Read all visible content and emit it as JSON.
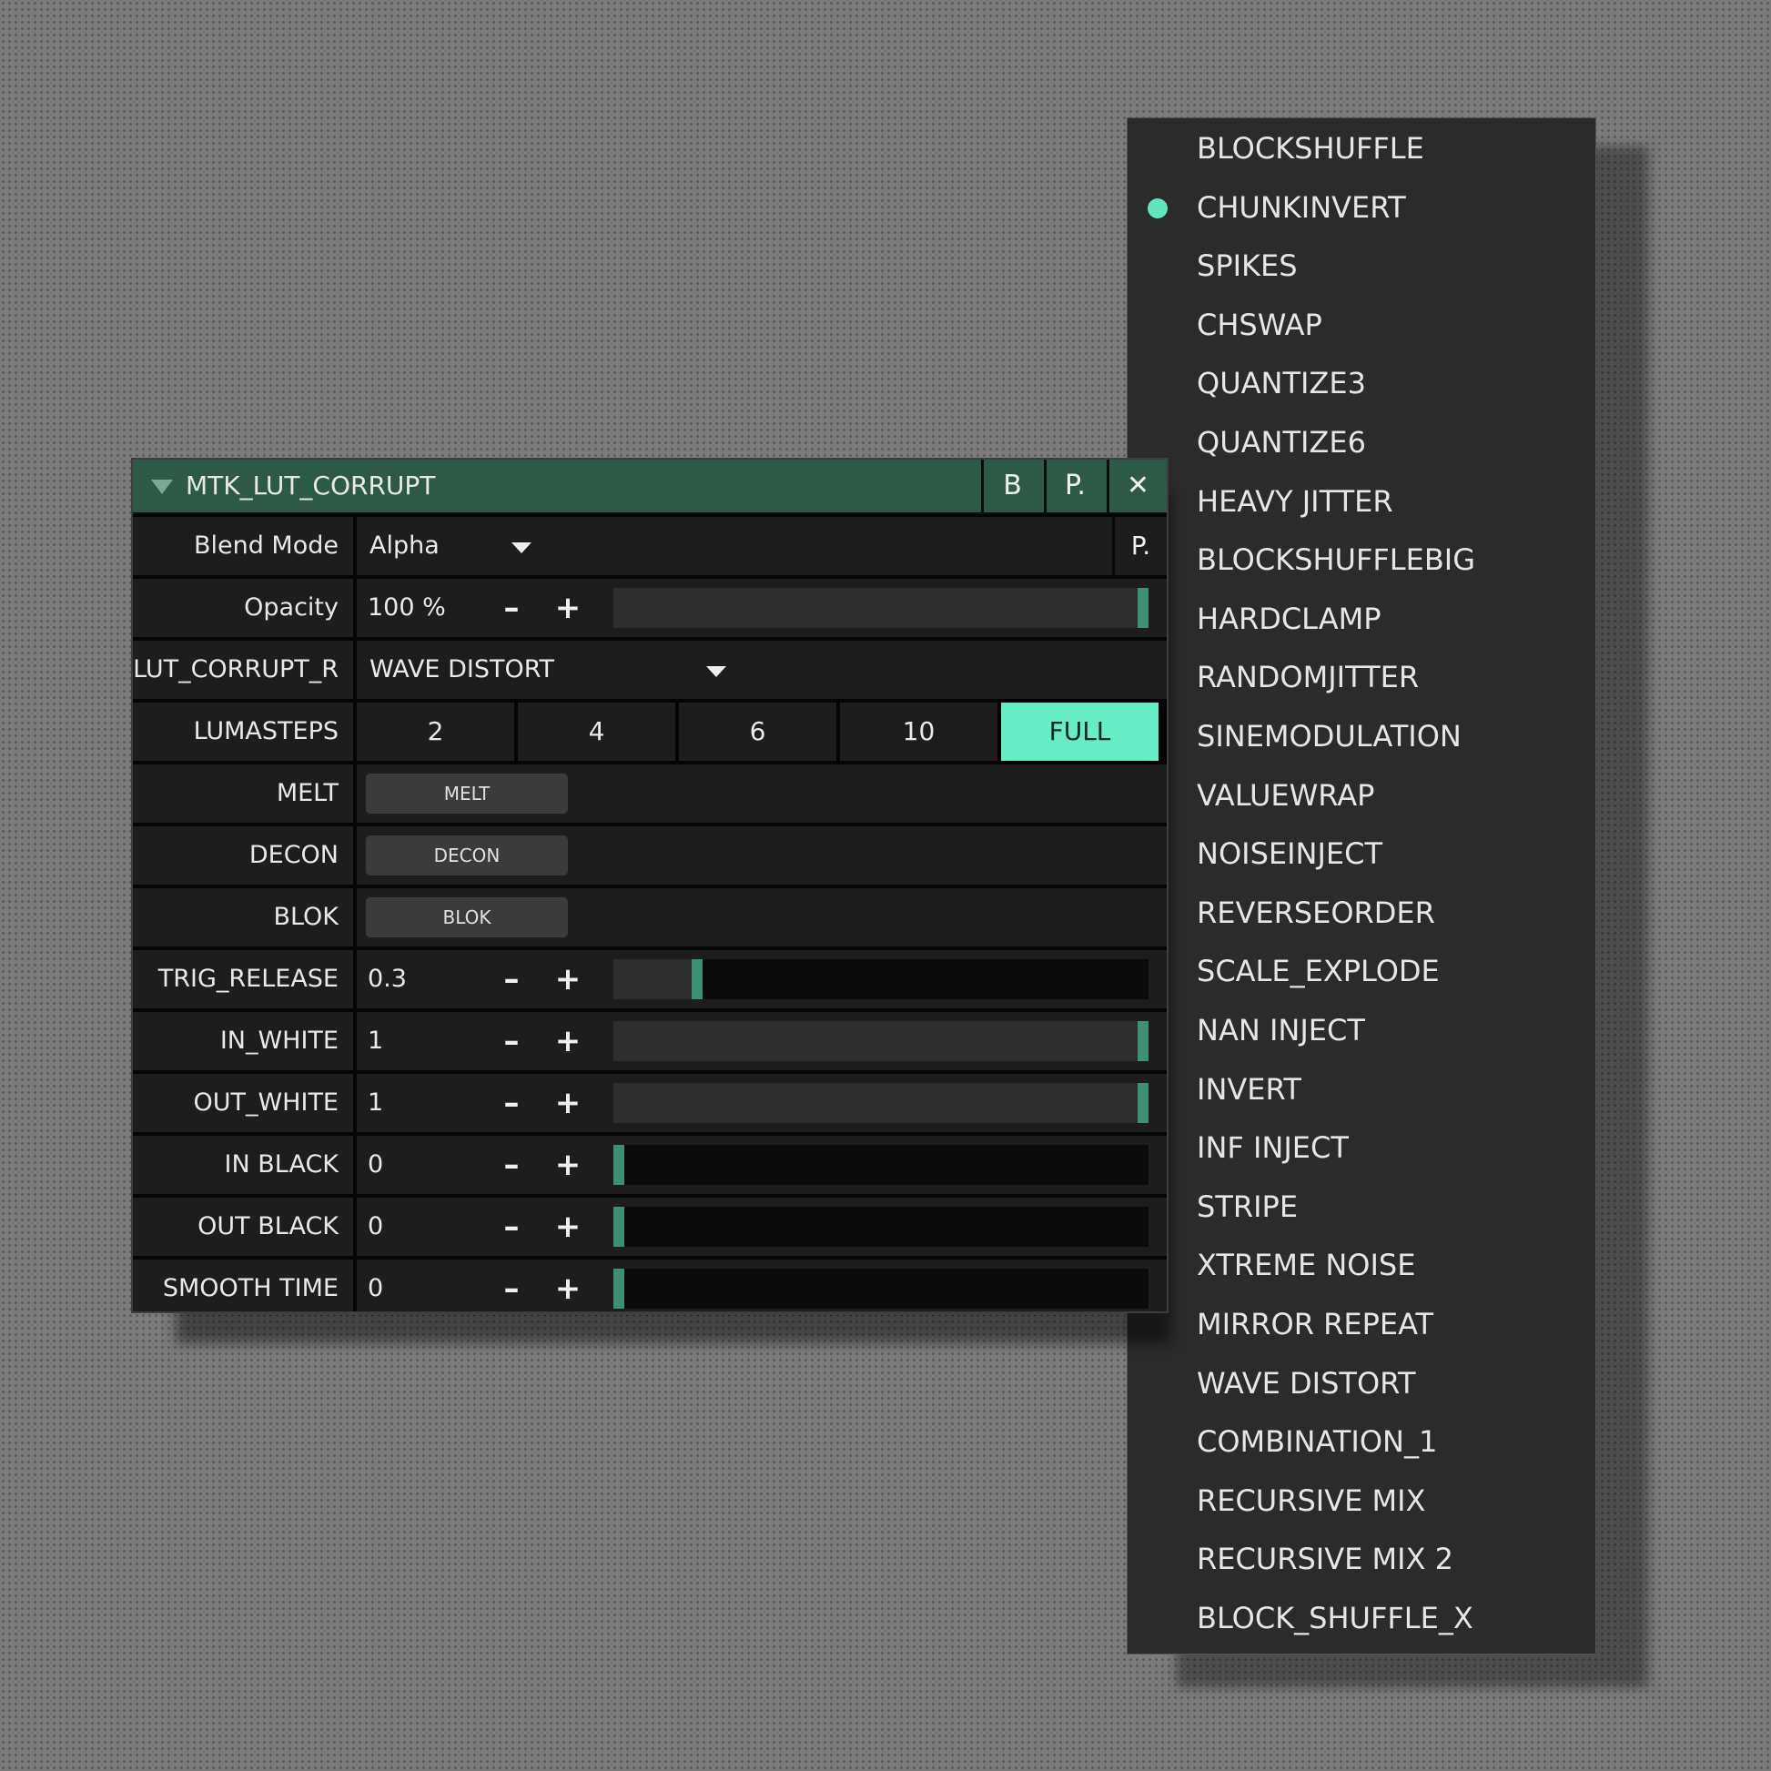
{
  "menu": {
    "selected_index": 1,
    "items": [
      "BLOCKSHUFFLE",
      "CHUNKINVERT",
      "SPIKES",
      "CHSWAP",
      "QUANTIZE3",
      "QUANTIZE6",
      "HEAVY JITTER",
      "BLOCKSHUFFLEBIG",
      "HARDCLAMP",
      "RANDOMJITTER",
      "SINEMODULATION",
      "VALUEWRAP",
      "NOISEINJECT",
      "REVERSEORDER",
      "SCALE_EXPLODE",
      "NAN INJECT",
      "INVERT",
      "INF INJECT",
      "STRIPE",
      "XTREME NOISE",
      "MIRROR REPEAT",
      "WAVE DISTORT",
      "COMBINATION_1",
      "RECURSIVE MIX",
      "RECURSIVE MIX 2",
      "BLOCK_SHUFFLE_X"
    ]
  },
  "panel": {
    "title": "MTK_LUT_CORRUPT",
    "title_buttons": {
      "bypass": "B",
      "presets": "P.",
      "close": "✕"
    },
    "blend_mode": {
      "label": "Blend Mode",
      "value": "Alpha",
      "presets_button": "P."
    },
    "opacity": {
      "label": "Opacity",
      "value": "100 %",
      "fraction": 1.0
    },
    "lut_corrupt": {
      "label": "LUT_CORRUPT_R",
      "value": "WAVE DISTORT"
    },
    "lumasteps": {
      "label": "LUMASTEPS",
      "options": [
        "2",
        "4",
        "6",
        "10",
        "FULL"
      ],
      "active_index": 4
    },
    "melt": {
      "label": "MELT",
      "button": "MELT"
    },
    "decon": {
      "label": "DECON",
      "button": "DECON"
    },
    "blok": {
      "label": "BLOK",
      "button": "BLOK"
    },
    "sliders": [
      {
        "label": "TRIG_RELEASE",
        "value": "0.3",
        "fraction": 0.15
      },
      {
        "label": "IN_WHITE",
        "value": "1",
        "fraction": 1.0
      },
      {
        "label": "OUT_WHITE",
        "value": "1",
        "fraction": 1.0
      },
      {
        "label": "IN BLACK",
        "value": "0",
        "fraction": 0.0
      },
      {
        "label": "OUT BLACK",
        "value": "0",
        "fraction": 0.0
      },
      {
        "label": "SMOOTH TIME",
        "value": "0",
        "fraction": 0.0
      }
    ],
    "stepper": {
      "minus": "–",
      "plus": "+"
    }
  },
  "colors": {
    "accent": "#68ecc5",
    "title_bar": "#2c5a46",
    "slider_handle": "#3f8f72"
  }
}
